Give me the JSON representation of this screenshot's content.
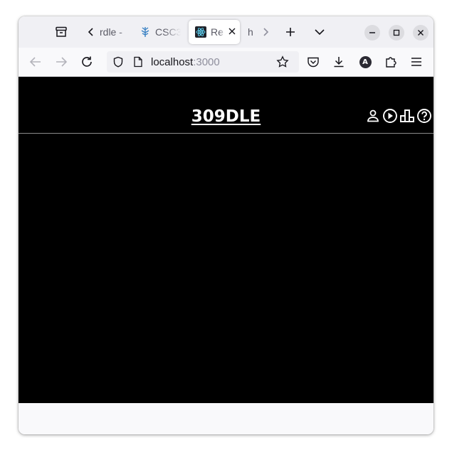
{
  "browser": {
    "tabs": [
      {
        "label": "rdle -",
        "icon": "page-icon"
      },
      {
        "label": "CSC3",
        "icon": "tree-icon"
      },
      {
        "label": "Re",
        "icon": "react-icon",
        "active": true
      },
      {
        "label": "h",
        "icon": "none"
      }
    ],
    "url": {
      "host": "localhost",
      "port": ":3000"
    },
    "account_initial": "A"
  },
  "page": {
    "title": "309DLE",
    "header_icons": [
      "user-icon",
      "play-icon",
      "leaderboard-icon",
      "help-icon"
    ],
    "background": "#000000",
    "text_color": "#ffffff"
  }
}
